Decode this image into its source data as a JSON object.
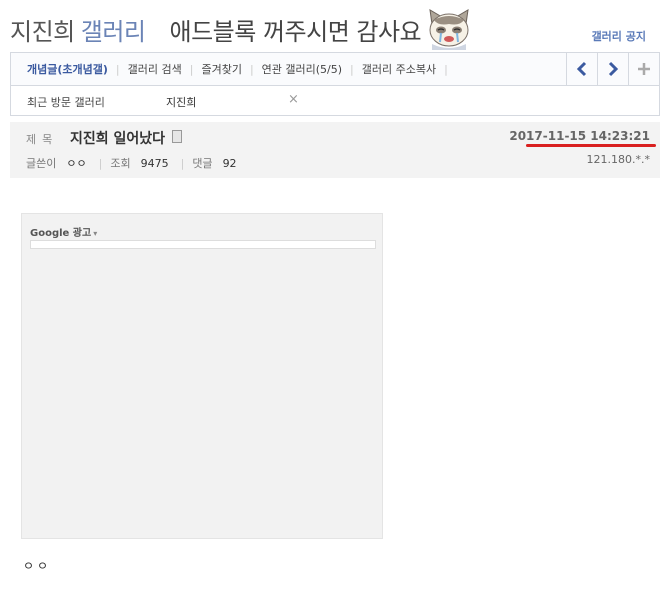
{
  "header": {
    "gallery_name": "지진희",
    "gallery_suffix": "갤러리",
    "slogan": "애드블록 꺼주시면 감사요",
    "notice_link": "갤러리 공지"
  },
  "nav": {
    "items": [
      {
        "label": "개념글(초개념갤)",
        "active": true
      },
      {
        "label": "갤러리 검색"
      },
      {
        "label": "즐겨찾기"
      },
      {
        "label": "연관 갤러리(5/5)"
      },
      {
        "label": "갤러리 주소복사"
      }
    ],
    "prev_icon": "chevron-left-icon",
    "next_icon": "chevron-right-icon",
    "add_icon": "plus-icon",
    "accent_color": "#3b5aa0"
  },
  "recent": {
    "label": "최근 방문 갤러리",
    "item": "지진희",
    "close": "×"
  },
  "post": {
    "subject_label": "제목",
    "subject": "지진희 일어났다",
    "date": "2017-11-15 14:23:21",
    "author_label": "글쓴이",
    "author": "ㅇㅇ",
    "views_label": "조회",
    "views": "9475",
    "comments_label": "댓글",
    "comments": "92",
    "ip": "121.180.*.*",
    "highlight_color": "#d9201f"
  },
  "ad": {
    "label": "Google 광고",
    "caret": "▾"
  },
  "body": {
    "text": "ㅇㅇ"
  }
}
